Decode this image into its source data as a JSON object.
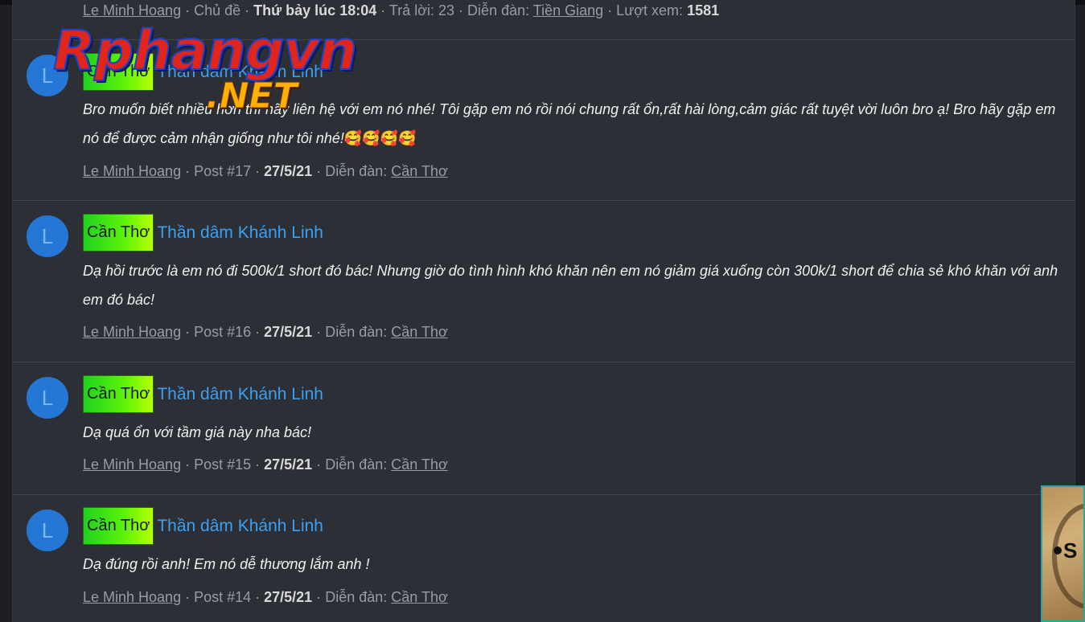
{
  "top_row": {
    "author": "Le Minh Hoang",
    "sep1": " · Chủ đề · ",
    "date": "Thứ bảy lúc 18:04",
    "sep2": " · Trả lời: 23 · Diễn đàn: ",
    "forum": "Tiền Giang",
    "sep3": " · Lượt xem: ",
    "views": "1581"
  },
  "posts": [
    {
      "avatar_letter": "L",
      "prefix": "Cần Thơ",
      "title": "Thần dâm Khánh Linh",
      "snippet": "Bro muốn biết nhiều hơn thì hãy liên hệ với em nó nhé! Tôi gặp em nó rồi nói chung rất ổn,rất hài lòng,cảm giác rất tuyệt vời luôn bro ạ! Bro hãy gặp em nó để được cảm nhận giống như tôi nhé!",
      "emoji": "🥰🥰🥰🥰",
      "author": "Le Minh Hoang",
      "post_no": " · Post #17 · ",
      "date": "27/5/21",
      "forum_label": " · Diễn đàn: ",
      "forum": "Cần Thơ"
    },
    {
      "avatar_letter": "L",
      "prefix": "Cần Thơ",
      "title": "Thần dâm Khánh Linh",
      "snippet": "Dạ hồi trước là em nó đi 500k/1 short đó bác! Nhưng giờ do tình hình khó khăn nên em nó giảm giá xuống còn 300k/1 short để chia sẻ khó khăn với anh em đó bác!",
      "emoji": "",
      "author": "Le Minh Hoang",
      "post_no": " · Post #16 · ",
      "date": "27/5/21",
      "forum_label": " · Diễn đàn: ",
      "forum": "Cần Thơ"
    },
    {
      "avatar_letter": "L",
      "prefix": "Cần Thơ",
      "title": "Thần dâm Khánh Linh",
      "snippet": "Dạ quá ổn với tầm giá này nha bác!",
      "emoji": "",
      "author": "Le Minh Hoang",
      "post_no": " · Post #15 · ",
      "date": "27/5/21",
      "forum_label": " · Diễn đàn: ",
      "forum": "Cần Thơ"
    },
    {
      "avatar_letter": "L",
      "prefix": "Cần Thơ",
      "title": "Thần dâm Khánh Linh",
      "snippet": "Dạ đúng rồi anh! Em nó dễ thương lắm anh !",
      "emoji": "",
      "author": "Le Minh Hoang",
      "post_no": " · Post #14 · ",
      "date": "27/5/21",
      "forum_label": " · Diễn đàn: ",
      "forum": "Cần Thơ"
    }
  ],
  "watermark": {
    "main": "Rphangvn",
    "suffix": ".NET"
  },
  "ad_banner": {
    "text": "S"
  },
  "colors": {
    "prefix_green": "#1fd11f",
    "link_blue": "#3aa0f2",
    "avatar_blue": "#2577d6"
  }
}
